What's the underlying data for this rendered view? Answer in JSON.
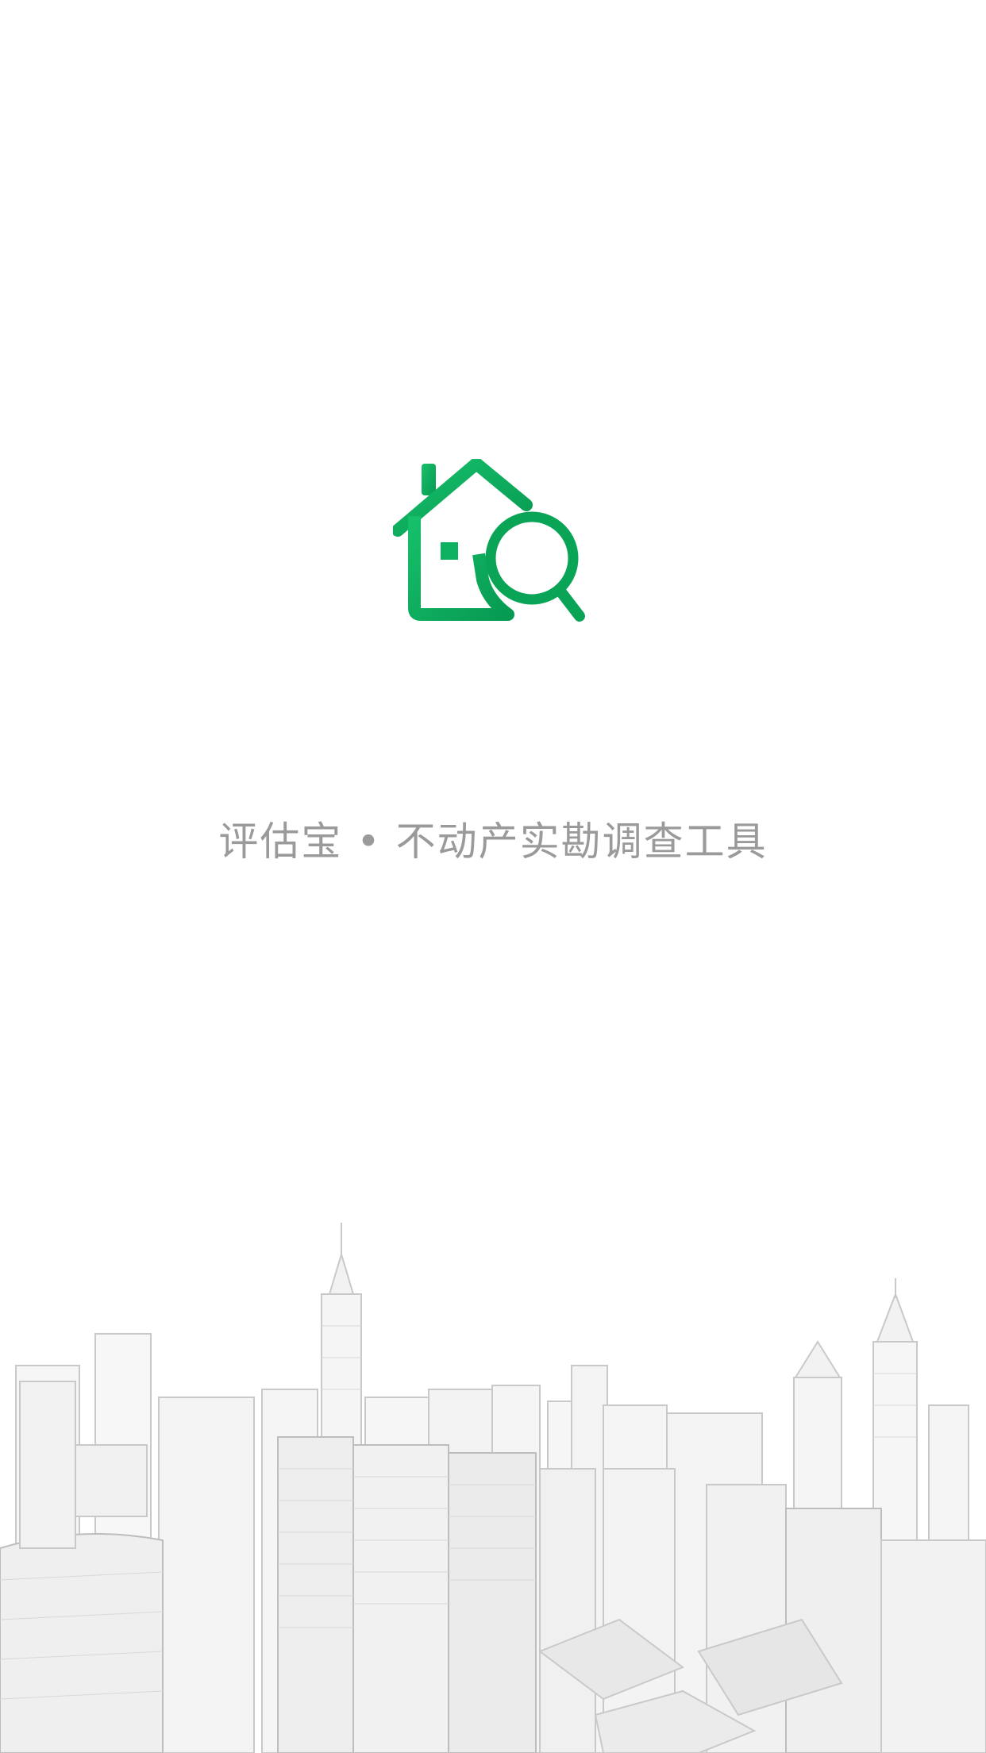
{
  "app": {
    "logo_icon": "house-magnifier-icon",
    "tagline": "评估宝 • 不动产实勘调查工具",
    "brand_color": "#0db160",
    "brand_color_dark": "#0a9a55",
    "tagline_color": "#9a9a9a",
    "background_illustration": "city-skyline-sketch"
  }
}
